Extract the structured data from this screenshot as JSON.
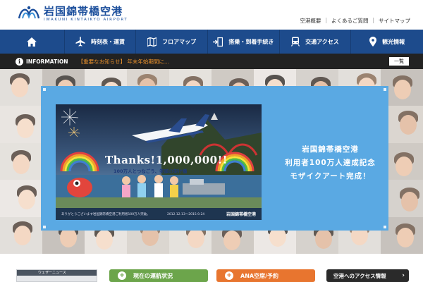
{
  "site": {
    "logo_text": "岩国錦帯橋空港",
    "logo_subtext": "IWAKUNI KINTAIKYO AIRPORT",
    "logo_color": "#1c4f9c"
  },
  "top_links": [
    "空港概要",
    "よくあるご質問",
    "サイトマップ"
  ],
  "nav": {
    "background": "#1d4b8c",
    "items": [
      {
        "label": "",
        "icon": "home-icon"
      },
      {
        "label": "時刻表・運賃",
        "icon": "airplane-icon"
      },
      {
        "label": "フロアマップ",
        "icon": "map-icon"
      },
      {
        "label": "搭乗・到着手続き",
        "icon": "boarding-icon"
      },
      {
        "label": "交通アクセス",
        "icon": "train-icon"
      },
      {
        "label": "観光情報",
        "icon": "location-pin-icon"
      }
    ]
  },
  "info": {
    "label": "INFORMATION",
    "text": "【重要なお知らせ】 年末年始期間に...",
    "list_button": "一覧"
  },
  "hero": {
    "title_lines": [
      "岩国錦帯橋空港",
      "利用者100万人達成記念",
      "モザイクアート完成！"
    ],
    "panel_color": "#5aa9e3",
    "poster": {
      "thanks": "Thanks!1,000,000!!",
      "subtitle": "100万人とつなごう、笑顔の架け橋",
      "note": "ありがとうございます岩国錦帯橋空港ご利用者100万人突破。",
      "period": "2012.12.13〜2015.9.24",
      "logo": "岩国錦帯橋空港"
    }
  },
  "bottom": {
    "weather_label": "ウェザーニュース",
    "buttons": [
      {
        "label": "現在の運航状況",
        "color": "#6ca54b"
      },
      {
        "label": "ANA空席/予約",
        "color": "#e8752f"
      },
      {
        "label": "空港へのアクセス情報",
        "color": "#2a2a2a"
      }
    ]
  }
}
